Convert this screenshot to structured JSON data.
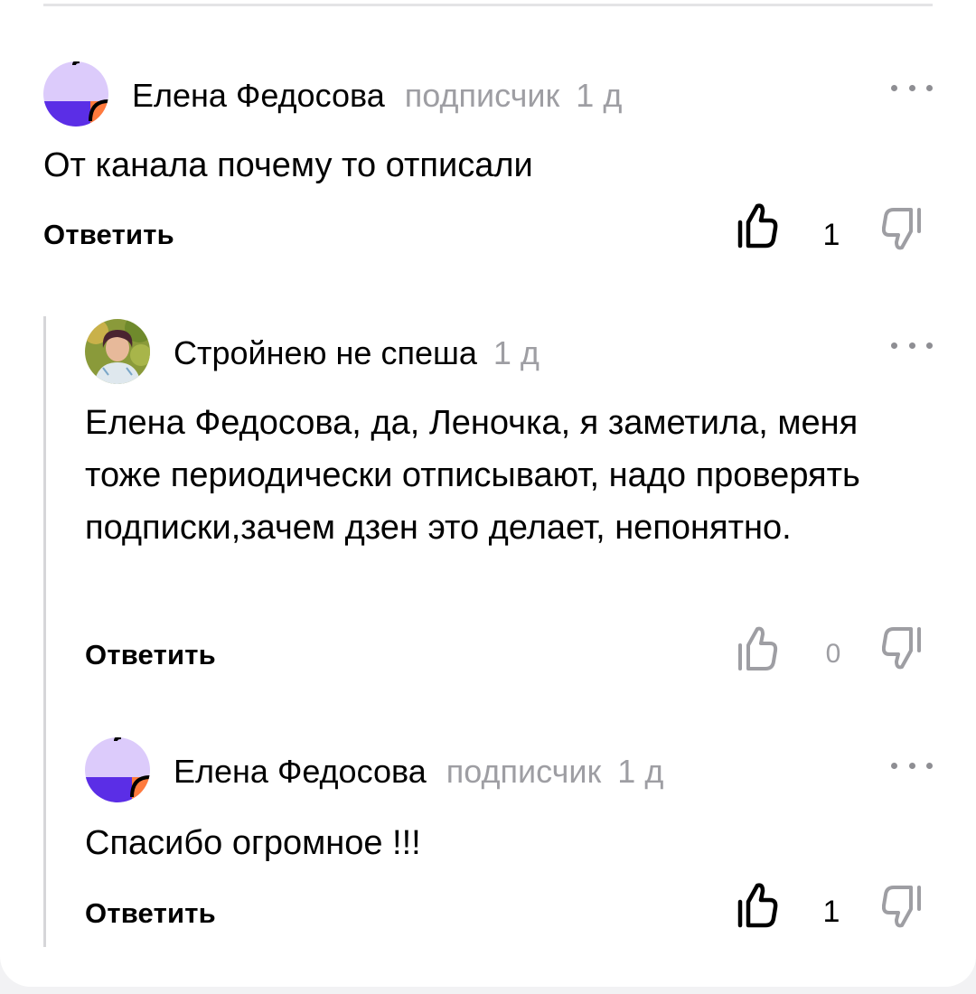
{
  "comments": [
    {
      "author": "Елена Федосова",
      "badge": "подписчик",
      "time": "1 д",
      "text": "От канала почему то отписали",
      "reply_label": "Ответить",
      "likes": "1",
      "liked": true
    },
    {
      "author": "Стройнею не спеша",
      "badge": "",
      "time": "1 д",
      "text": "Елена Федосова, да, Леночка, я заметила, меня тоже периодически отписывают, надо проверять подписки,зачем дзен это делает, непонятно.",
      "reply_label": "Ответить",
      "likes": "0",
      "liked": false
    },
    {
      "author": "Елена Федосова",
      "badge": "подписчик",
      "time": "1 д",
      "text": "Спасибо огромное !!!",
      "reply_label": "Ответить",
      "likes": "1",
      "liked": true
    }
  ],
  "colors": {
    "avatar_bg": "#dccbfb",
    "avatar_purple": "#5b2ee6",
    "avatar_orange": "#ff7a3d",
    "muted": "#9e9ea3",
    "thread_line": "#d6d6d9"
  },
  "icons": [
    "avatar-icon",
    "more-icon",
    "thumbs-up-icon",
    "thumbs-down-icon"
  ]
}
